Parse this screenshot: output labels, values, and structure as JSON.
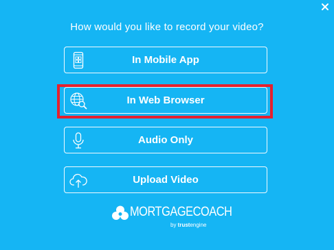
{
  "dialog": {
    "prompt": "How would you like to record your video?",
    "close_icon": "close-icon"
  },
  "options": [
    {
      "label": "In Mobile App",
      "icon": "mobile-phone-icon"
    },
    {
      "label": "In Web Browser",
      "icon": "globe-search-icon",
      "highlighted": true
    },
    {
      "label": "Audio Only",
      "icon": "microphone-icon"
    },
    {
      "label": "Upload Video",
      "icon": "cloud-upload-icon"
    }
  ],
  "logo": {
    "name": "MORTGAGECOACH",
    "by": "by",
    "brand_bold": "trust",
    "brand_rest": "engine"
  },
  "colors": {
    "background": "#15b5f4",
    "text": "#ffffff",
    "highlight": "#e5202e"
  }
}
